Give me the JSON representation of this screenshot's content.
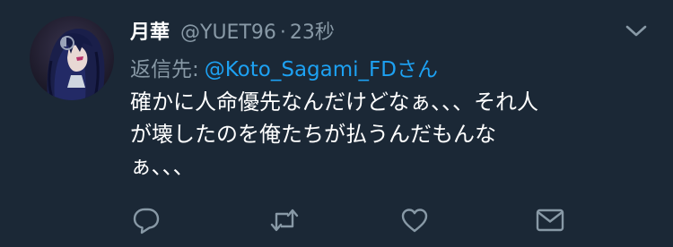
{
  "tweet": {
    "display_name": "月華",
    "handle": "@YUET96",
    "separator": "·",
    "time": "23秒",
    "reply_prefix": "返信先:",
    "reply_target": "@Koto_Sagami_FDさん",
    "body_lines": [
      "確かに人命優先なんだけどなぁ、、、それ人",
      "が壊したのを俺たちが払うんだもんな",
      "ぁ、、、"
    ]
  },
  "actions": [
    {
      "icon": "reply-icon"
    },
    {
      "icon": "retweet-icon"
    },
    {
      "icon": "like-icon"
    },
    {
      "icon": "direct-message-icon"
    }
  ],
  "colors": {
    "background": "#1b2836",
    "text": "#ffffff",
    "secondary": "#8899a6",
    "accent": "#1da1f2"
  }
}
